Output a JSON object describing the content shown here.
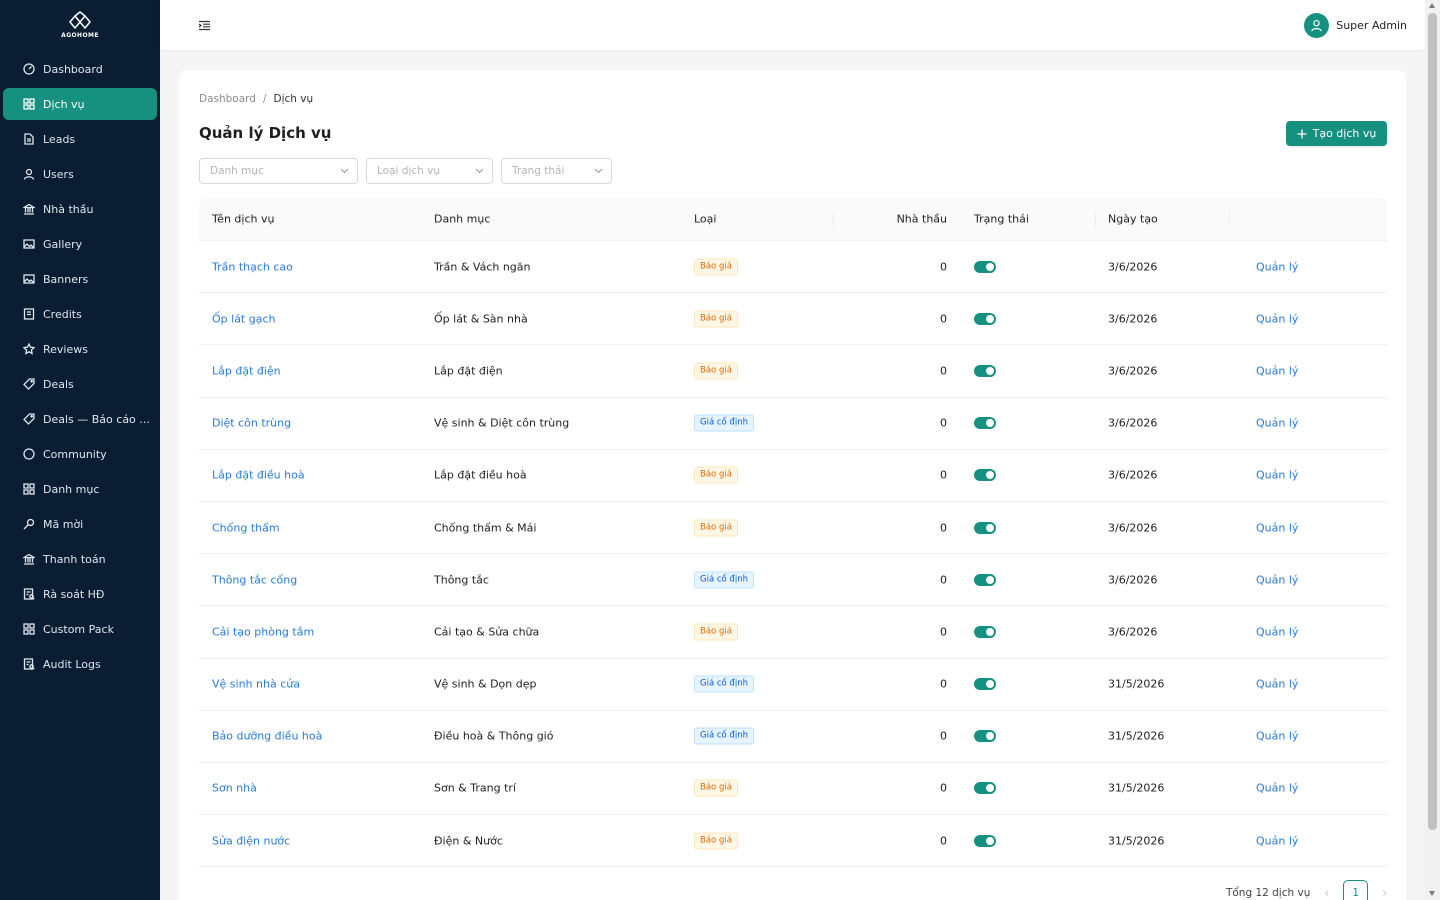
{
  "brand": {
    "name": "AGOHOME",
    "accent": "#16917f",
    "sidebar_bg": "#0a1d33"
  },
  "sidebar": {
    "items": [
      {
        "label": "Dashboard",
        "icon": "dashboard-icon",
        "active": false
      },
      {
        "label": "Dịch vụ",
        "icon": "grid-icon",
        "active": true
      },
      {
        "label": "Leads",
        "icon": "file-icon",
        "active": false
      },
      {
        "label": "Users",
        "icon": "user-icon",
        "active": false
      },
      {
        "label": "Nhà thầu",
        "icon": "bank-icon",
        "active": false
      },
      {
        "label": "Gallery",
        "icon": "picture-icon",
        "active": false
      },
      {
        "label": "Banners",
        "icon": "picture-icon",
        "active": false
      },
      {
        "label": "Credits",
        "icon": "book-icon",
        "active": false
      },
      {
        "label": "Reviews",
        "icon": "star-icon",
        "active": false
      },
      {
        "label": "Deals",
        "icon": "tag-icon",
        "active": false
      },
      {
        "label": "Deals — Báo cáo ...",
        "icon": "tag-icon",
        "active": false
      },
      {
        "label": "Community",
        "icon": "chat-icon",
        "active": false
      },
      {
        "label": "Danh mục",
        "icon": "grid-icon",
        "active": false
      },
      {
        "label": "Mã mời",
        "icon": "key-icon",
        "active": false
      },
      {
        "label": "Thanh toán",
        "icon": "bank-icon",
        "active": false
      },
      {
        "label": "Rà soát HĐ",
        "icon": "audit-icon",
        "active": false
      },
      {
        "label": "Custom Pack",
        "icon": "grid-icon",
        "active": false
      },
      {
        "label": "Audit Logs",
        "icon": "audit-icon",
        "active": false
      }
    ]
  },
  "header": {
    "user_name": "Super Admin"
  },
  "breadcrumb": {
    "root": "Dashboard",
    "separator": "/",
    "current": "Dịch vụ"
  },
  "page": {
    "title": "Quản lý Dịch vụ",
    "create_button": "Tạo dịch vụ"
  },
  "filters": {
    "category_placeholder": "Danh mục",
    "type_placeholder": "Loại dịch vụ",
    "status_placeholder": "Trạng thái"
  },
  "table": {
    "columns": {
      "name": "Tên dịch vụ",
      "category": "Danh mục",
      "type": "Loại",
      "contractors": "Nhà thầu",
      "status": "Trạng thái",
      "created": "Ngày tạo"
    },
    "rows": [
      {
        "name": "Trần thạch cao",
        "category": "Trần & Vách ngăn",
        "type": "Báo giá",
        "type_kind": "quote",
        "contractors": "0",
        "status_on": true,
        "created": "3/6/2026",
        "action": "Quản lý"
      },
      {
        "name": "Ốp lát gạch",
        "category": "Ốp lát & Sàn nhà",
        "type": "Báo giá",
        "type_kind": "quote",
        "contractors": "0",
        "status_on": true,
        "created": "3/6/2026",
        "action": "Quản lý"
      },
      {
        "name": "Lắp đặt điện",
        "category": "Lắp đặt điện",
        "type": "Báo giá",
        "type_kind": "quote",
        "contractors": "0",
        "status_on": true,
        "created": "3/6/2026",
        "action": "Quản lý"
      },
      {
        "name": "Diệt côn trùng",
        "category": "Vệ sinh & Diệt côn trùng",
        "type": "Giá cố định",
        "type_kind": "fixed",
        "contractors": "0",
        "status_on": true,
        "created": "3/6/2026",
        "action": "Quản lý"
      },
      {
        "name": "Lắp đặt điều hoà",
        "category": "Lắp đặt điều hoà",
        "type": "Báo giá",
        "type_kind": "quote",
        "contractors": "0",
        "status_on": true,
        "created": "3/6/2026",
        "action": "Quản lý"
      },
      {
        "name": "Chống thấm",
        "category": "Chống thấm & Mái",
        "type": "Báo giá",
        "type_kind": "quote",
        "contractors": "0",
        "status_on": true,
        "created": "3/6/2026",
        "action": "Quản lý"
      },
      {
        "name": "Thông tắc cống",
        "category": "Thông tắc",
        "type": "Giá cố định",
        "type_kind": "fixed",
        "contractors": "0",
        "status_on": true,
        "created": "3/6/2026",
        "action": "Quản lý"
      },
      {
        "name": "Cải tạo phòng tắm",
        "category": "Cải tạo & Sửa chữa",
        "type": "Báo giá",
        "type_kind": "quote",
        "contractors": "0",
        "status_on": true,
        "created": "3/6/2026",
        "action": "Quản lý"
      },
      {
        "name": "Vệ sinh nhà cửa",
        "category": "Vệ sinh & Dọn dẹp",
        "type": "Giá cố định",
        "type_kind": "fixed",
        "contractors": "0",
        "status_on": true,
        "created": "31/5/2026",
        "action": "Quản lý"
      },
      {
        "name": "Bảo dưỡng điều hoà",
        "category": "Điều hoà & Thông gió",
        "type": "Giá cố định",
        "type_kind": "fixed",
        "contractors": "0",
        "status_on": true,
        "created": "31/5/2026",
        "action": "Quản lý"
      },
      {
        "name": "Sơn nhà",
        "category": "Sơn & Trang trí",
        "type": "Báo giá",
        "type_kind": "quote",
        "contractors": "0",
        "status_on": true,
        "created": "31/5/2026",
        "action": "Quản lý"
      },
      {
        "name": "Sửa điện nước",
        "category": "Điện & Nước",
        "type": "Báo giá",
        "type_kind": "quote",
        "contractors": "0",
        "status_on": true,
        "created": "31/5/2026",
        "action": "Quản lý"
      }
    ]
  },
  "pagination": {
    "total_text": "Tổng 12 dịch vụ",
    "current_page": "1"
  }
}
